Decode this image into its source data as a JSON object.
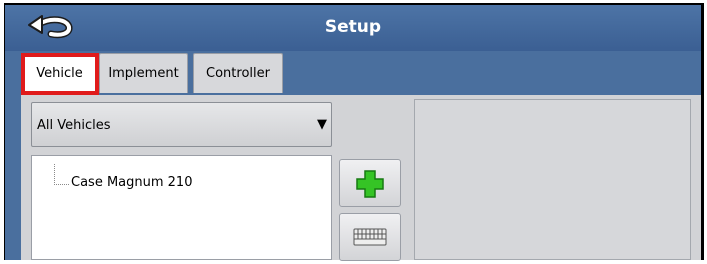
{
  "header": {
    "title": "Setup",
    "back_icon": "back-arrow-icon"
  },
  "tabs": [
    {
      "label": "Vehicle",
      "selected": true
    },
    {
      "label": "Implement",
      "selected": false
    },
    {
      "label": "Controller",
      "selected": false
    }
  ],
  "vehicle_filter": {
    "value": "All Vehicles",
    "arrow": "▼"
  },
  "vehicle_tree": {
    "items": [
      {
        "label": "Case Magnum 210"
      }
    ]
  },
  "buttons": {
    "add_icon": "green-plus-icon",
    "keyboard_icon": "keyboard-icon"
  },
  "colors": {
    "header": "#3f6497",
    "highlight": "#e01b1b",
    "add": "#35c425"
  }
}
